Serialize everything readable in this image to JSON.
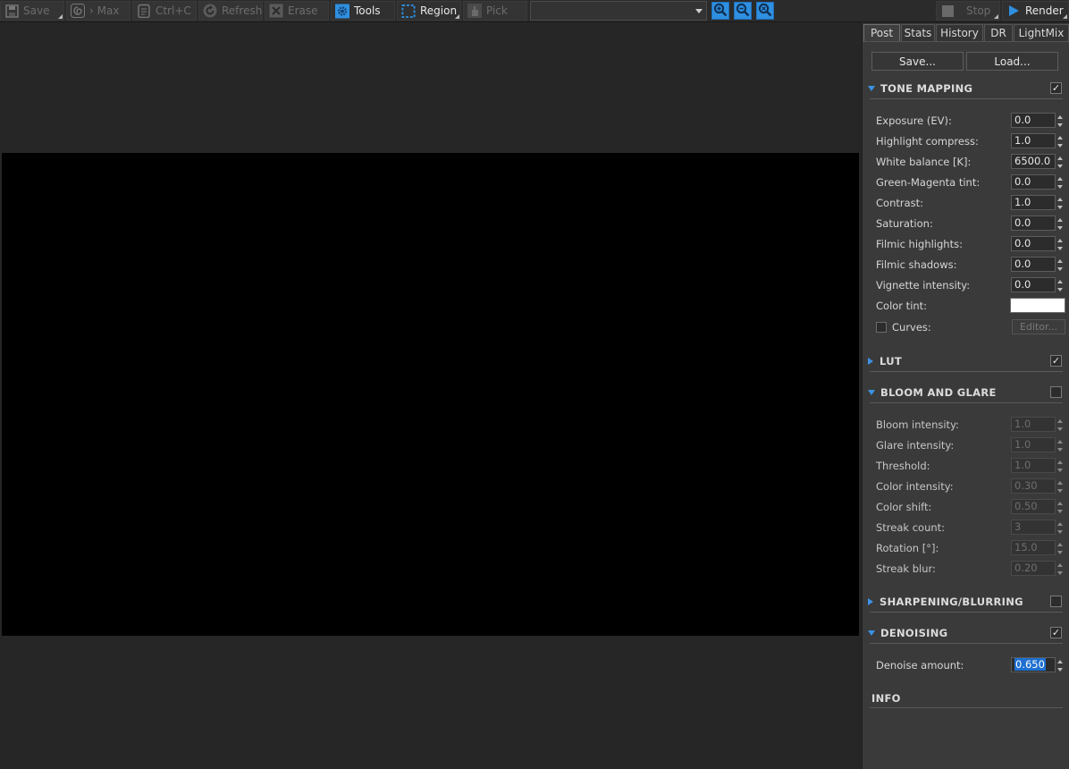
{
  "toolbar": {
    "save": "Save",
    "max": "› Max",
    "ctrlc": "Ctrl+C",
    "refresh": "Refresh",
    "erase": "Erase",
    "tools": "Tools",
    "region": "Region",
    "pick": "Pick",
    "stop": "Stop",
    "render": "Render",
    "combo_value": ""
  },
  "tabs": [
    "Post",
    "Stats",
    "History",
    "DR",
    "LightMix"
  ],
  "panel": {
    "save_btn": "Save...",
    "load_btn": "Load...",
    "tone_mapping": {
      "title": "TONE MAPPING",
      "enabled": true,
      "params": [
        {
          "label": "Exposure (EV):",
          "value": "0.0"
        },
        {
          "label": "Highlight compress:",
          "value": "1.0"
        },
        {
          "label": "White balance [K]:",
          "value": "6500.0"
        },
        {
          "label": "Green-Magenta tint:",
          "value": "0.0"
        },
        {
          "label": "Contrast:",
          "value": "1.0"
        },
        {
          "label": "Saturation:",
          "value": "0.0"
        },
        {
          "label": "Filmic highlights:",
          "value": "0.0"
        },
        {
          "label": "Filmic shadows:",
          "value": "0.0"
        },
        {
          "label": "Vignette intensity:",
          "value": "0.0"
        }
      ],
      "color_tint_label": "Color tint:",
      "color_tint_value": "#ffffff",
      "curves_label": "Curves:",
      "editor_btn": "Editor..."
    },
    "lut": {
      "title": "LUT",
      "enabled": true
    },
    "bloom": {
      "title": "BLOOM AND GLARE",
      "enabled": false,
      "params": [
        {
          "label": "Bloom intensity:",
          "value": "1.0"
        },
        {
          "label": "Glare intensity:",
          "value": "1.0"
        },
        {
          "label": "Threshold:",
          "value": "1.0"
        },
        {
          "label": "Color intensity:",
          "value": "0.30"
        },
        {
          "label": "Color shift:",
          "value": "0.50"
        },
        {
          "label": "Streak count:",
          "value": "3"
        },
        {
          "label": "Rotation [°]:",
          "value": "15.0"
        },
        {
          "label": "Streak blur:",
          "value": "0.20"
        }
      ]
    },
    "sharpening": {
      "title": "SHARPENING/BLURRING",
      "enabled": false
    },
    "denoising": {
      "title": "DENOISING",
      "enabled": true,
      "param_label": "Denoise amount:",
      "param_value": "0.650"
    },
    "info_title": "INFO"
  },
  "colors": {
    "accent": "#2f8fe0",
    "panel_bg": "#3a3a3a",
    "viewport_bg": "#262626",
    "render_bg": "#000000"
  }
}
